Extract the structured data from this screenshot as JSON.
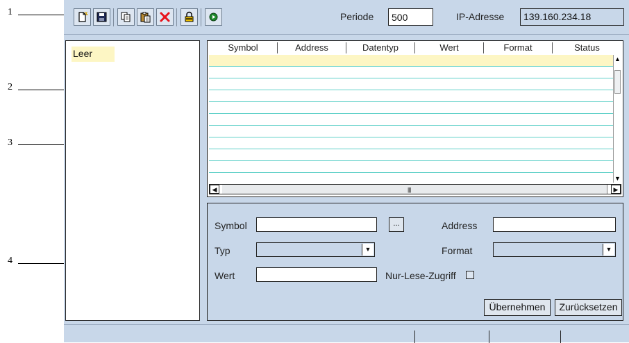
{
  "callouts": [
    "1",
    "2",
    "3",
    "4"
  ],
  "toolbar": {
    "buttons": [
      {
        "name": "new-icon"
      },
      {
        "name": "save-icon"
      },
      {
        "name": "copy-icon"
      },
      {
        "name": "paste-icon"
      },
      {
        "name": "delete-icon"
      },
      {
        "name": "lock-icon"
      },
      {
        "name": "run-icon"
      }
    ],
    "period_label": "Periode",
    "period_value": "500",
    "ip_label": "IP-Adresse",
    "ip_value": "139.160.234.18"
  },
  "tree": {
    "items": [
      "Leer"
    ]
  },
  "grid": {
    "columns": [
      "Symbol",
      "Address",
      "Datentyp",
      "Wert",
      "Format",
      "Status"
    ],
    "selected_row": 0,
    "row_count": 11
  },
  "form": {
    "symbol_label": "Symbol",
    "symbol_value": "",
    "browse_label": "...",
    "address_label": "Address",
    "address_value": "",
    "type_label": "Typ",
    "type_value": "",
    "format_label": "Format",
    "format_value": "",
    "value_label": "Wert",
    "value_value": "",
    "readonly_label": "Nur-Lese-Zugriff",
    "readonly_checked": false,
    "apply_label": "Übernehmen",
    "reset_label": "Zurücksetzen"
  },
  "colors": {
    "app_bg": "#c8d7e9",
    "selection": "#fdf6c4",
    "grid_line": "#5fd0c8",
    "delete_red": "#e8121a",
    "run_green": "#1f8a2e"
  }
}
